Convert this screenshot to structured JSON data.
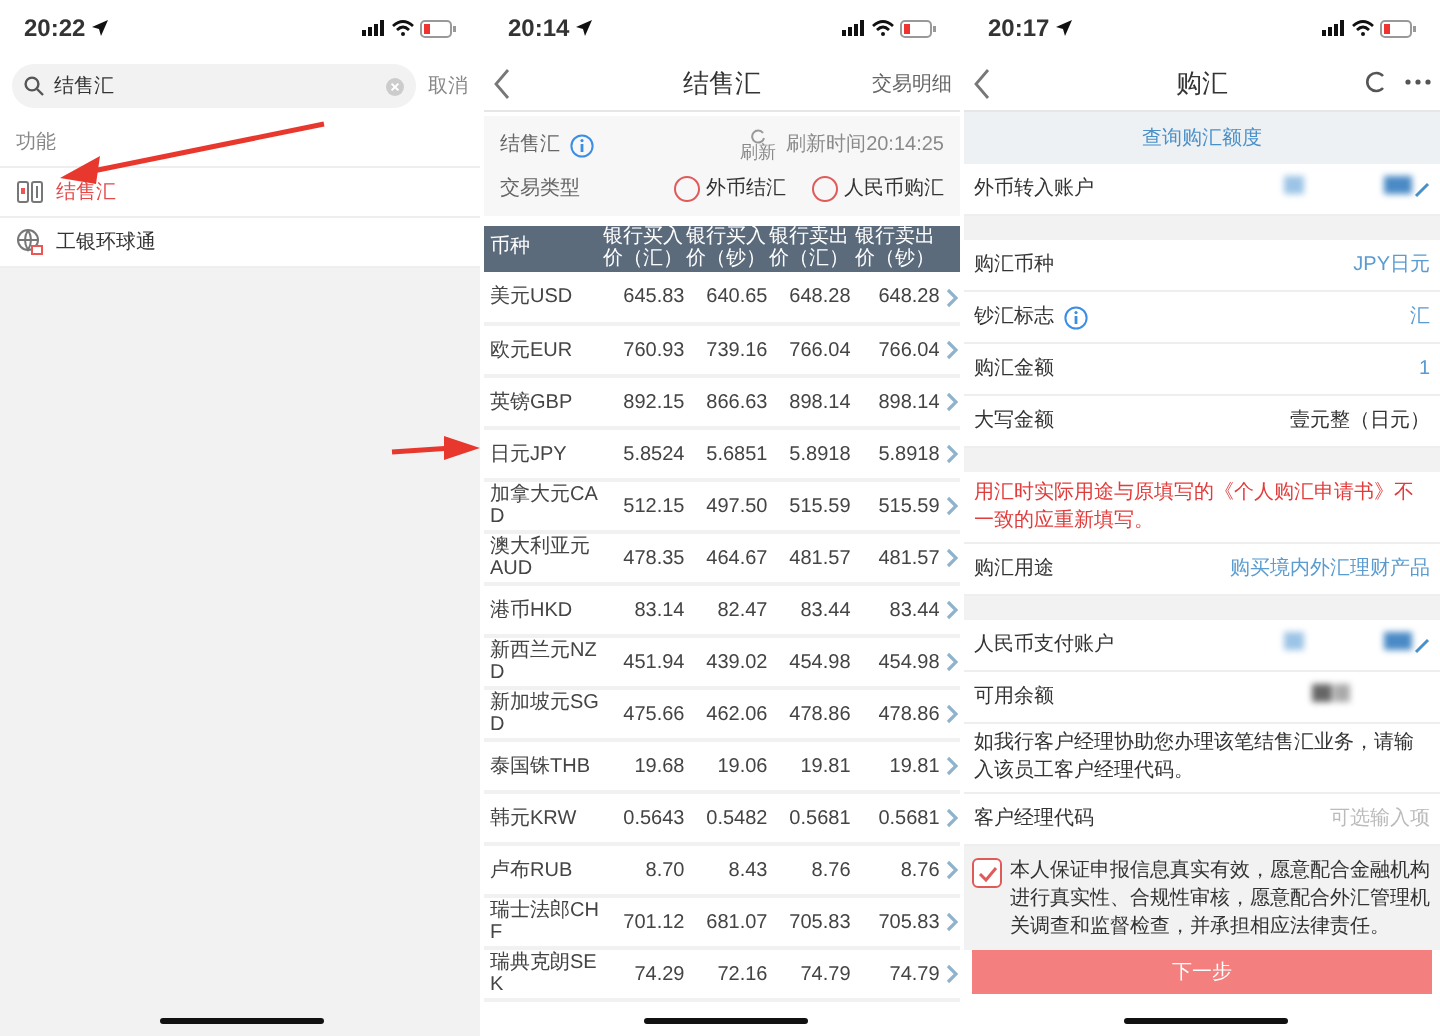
{
  "search_screen": {
    "status_time": "20:22",
    "search": {
      "value": "结售汇"
    },
    "cancel": "取消",
    "section": "功能",
    "results": [
      {
        "label": "结售汇",
        "highlighted": true
      },
      {
        "label": "工银环球通",
        "highlighted": false
      }
    ]
  },
  "rates_screen": {
    "status_time": "20:14",
    "title": "结售汇",
    "header_link": "交易明细",
    "info_label": "结售汇",
    "refresh": "刷新",
    "refresh_time": "刷新时间20:14:25",
    "type_label": "交易类型",
    "types": [
      {
        "label": "外币结汇",
        "selected": false
      },
      {
        "label": "人民币购汇",
        "selected": false
      }
    ],
    "table": {
      "columns": [
        "币种",
        "银行买入价（汇）",
        "银行买入价（钞）",
        "银行卖出价（汇）",
        "银行卖出价（钞）"
      ],
      "rows": [
        [
          "美元USD",
          "645.83",
          "640.65",
          "648.28",
          "648.28"
        ],
        [
          "欧元EUR",
          "760.93",
          "739.16",
          "766.04",
          "766.04"
        ],
        [
          "英镑GBP",
          "892.15",
          "866.63",
          "898.14",
          "898.14"
        ],
        [
          "日元JPY",
          "5.8524",
          "5.6851",
          "5.8918",
          "5.8918"
        ],
        [
          "加拿大元CAD",
          "512.15",
          "497.50",
          "515.59",
          "515.59"
        ],
        [
          "澳大利亚元AUD",
          "478.35",
          "464.67",
          "481.57",
          "481.57"
        ],
        [
          "港币HKD",
          "83.14",
          "82.47",
          "83.44",
          "83.44"
        ],
        [
          "新西兰元NZD",
          "451.94",
          "439.02",
          "454.98",
          "454.98"
        ],
        [
          "新加坡元SGD",
          "475.66",
          "462.06",
          "478.86",
          "478.86"
        ],
        [
          "泰国铢THB",
          "19.68",
          "19.06",
          "19.81",
          "19.81"
        ],
        [
          "韩元KRW",
          "0.5643",
          "0.5482",
          "0.5681",
          "0.5681"
        ],
        [
          "卢布RUB",
          "8.70",
          "8.43",
          "8.76",
          "8.76"
        ],
        [
          "瑞士法郎CHF",
          "701.12",
          "681.07",
          "705.83",
          "705.83"
        ],
        [
          "瑞典克朗SEK",
          "74.29",
          "72.16",
          "74.79",
          "74.79"
        ]
      ]
    }
  },
  "purchase_screen": {
    "status_time": "20:17",
    "title": "购汇",
    "quota_link": "查询购汇额度",
    "rows": [
      {
        "kind": "masked",
        "label": "外币转入账户",
        "editable": true,
        "gap_before": false
      },
      {
        "kind": "row",
        "label": "购汇币种",
        "value": "JPY日元",
        "selectable": true,
        "info": false,
        "gap_before": true
      },
      {
        "kind": "row",
        "label": "钞汇标志",
        "value": "汇",
        "selectable": true,
        "info": true,
        "gap_before": false
      },
      {
        "kind": "row",
        "label": "购汇金额",
        "value": "1",
        "selectable": true,
        "info": false,
        "gap_before": false
      },
      {
        "kind": "row",
        "label": "大写金额",
        "value": "壹元整（日元）",
        "selectable": false,
        "info": false,
        "gap_before": false
      },
      {
        "kind": "warning",
        "text": "用汇时实际用途与原填写的《个人购汇申请书》不一致的应重新填写。",
        "gap_before": true
      },
      {
        "kind": "row",
        "label": "购汇用途",
        "value": "购买境内外汇理财产品",
        "selectable": true,
        "info": false,
        "gap_before": false
      },
      {
        "kind": "masked",
        "label": "人民币支付账户",
        "editable": true,
        "gap_before": true
      },
      {
        "kind": "masked",
        "label": "可用余额",
        "editable": false,
        "gap_before": false
      },
      {
        "kind": "notice",
        "text": "如我行客户经理协助您办理该笔结售汇业务，请输入该员工客户经理代码。",
        "gap_before": false
      },
      {
        "kind": "input",
        "label": "客户经理代码",
        "placeholder": "可选输入项",
        "gap_before": false
      }
    ],
    "agree": {
      "checked": true,
      "text": "本人保证申报信息真实有效，愿意配合金融机构进行真实性、合规性审核，愿意配合外汇管理机关调查和监督检查，并承担相应法律责任。"
    },
    "next_button": "下一步"
  }
}
